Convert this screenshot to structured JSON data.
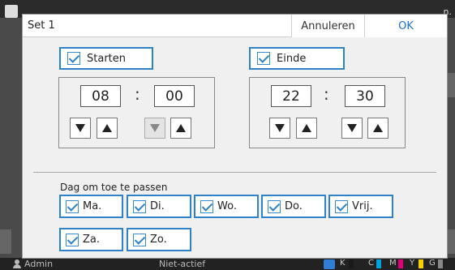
{
  "background": {
    "corner_text": "n.",
    "status": {
      "user": "Admin",
      "state": "Niet-actief",
      "ink_labels": [
        "K",
        "C",
        "M",
        "Y",
        "G"
      ],
      "ink_colors": [
        "#1a1a1a",
        "#00a0e0",
        "#e0007a",
        "#f5d000",
        "#888888"
      ]
    }
  },
  "dialog": {
    "title": "Set 1",
    "cancel_label": "Annuleren",
    "ok_label": "OK",
    "start": {
      "label": "Starten",
      "checked": true,
      "hour": "08",
      "minute": "00",
      "separator": ":"
    },
    "end": {
      "label": "Einde",
      "checked": true,
      "hour": "22",
      "minute": "30",
      "separator": ":"
    },
    "days_label": "Dag om toe te passen",
    "days": [
      {
        "label": "Ma.",
        "checked": true
      },
      {
        "label": "Di.",
        "checked": true
      },
      {
        "label": "Wo.",
        "checked": true
      },
      {
        "label": "Do.",
        "checked": true
      },
      {
        "label": "Vrij.",
        "checked": true
      },
      {
        "label": "Za.",
        "checked": true
      },
      {
        "label": "Zo.",
        "checked": true
      }
    ]
  },
  "colors": {
    "accent": "#2f82c8",
    "ok_text": "#1a6fc7"
  }
}
